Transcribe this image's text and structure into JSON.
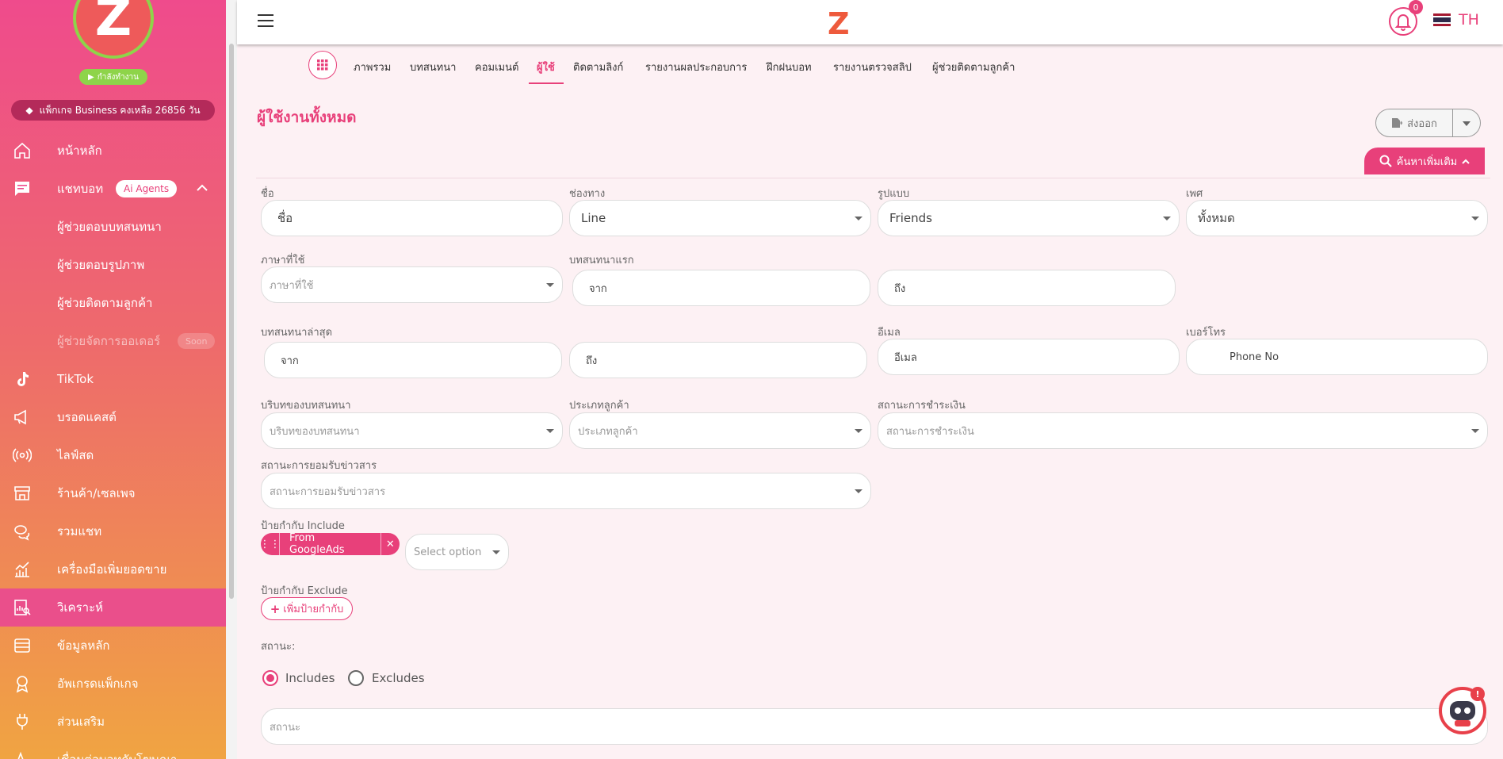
{
  "sidebar": {
    "status_label": "กำลังทำงาน",
    "package_label": "แพ็กเกจ Business คงเหลือ 26856 วัน",
    "items": [
      {
        "label": "หน้าหลัก",
        "icon": "home-icon"
      },
      {
        "label": "แชทบอท",
        "icon": "chat-icon",
        "badge": "Ai Agents"
      },
      {
        "label": "TikTok",
        "icon": "tiktok-icon"
      },
      {
        "label": "บรอดแคสต์",
        "icon": "megaphone-icon"
      },
      {
        "label": "ไลฟ์สด",
        "icon": "live-icon"
      },
      {
        "label": "ร้านค้า/เซลเพจ",
        "icon": "store-icon"
      },
      {
        "label": "รวมแชท",
        "icon": "chats-icon"
      },
      {
        "label": "เครื่องมือเพิ่มยอดขาย",
        "icon": "growth-icon"
      },
      {
        "label": "วิเคราะห์",
        "icon": "analytics-icon"
      },
      {
        "label": "ข้อมูลหลัก",
        "icon": "database-icon"
      },
      {
        "label": "อัพเกรดแพ็กเกจ",
        "icon": "award-icon"
      },
      {
        "label": "ส่วนเสริม",
        "icon": "plug-icon"
      },
      {
        "label": "เชื่อมต่อบอทกับโฆษณา",
        "icon": "ads-icon"
      }
    ],
    "subitems": [
      {
        "label": "ผู้ช่วยตอบบทสนทนา"
      },
      {
        "label": "ผู้ช่วยตอบรูปภาพ"
      },
      {
        "label": "ผู้ช่วยติดตามลูกค้า"
      },
      {
        "label": "ผู้ช่วยจัดการออเดอร์",
        "badge": "Soon"
      }
    ]
  },
  "topbar": {
    "notification_count": "0",
    "language": "TH"
  },
  "tabs": [
    "ภาพรวม",
    "บทสนทนา",
    "คอมเมนต์",
    "ผู้ใช้",
    "ติดตามลิงก์",
    "รายงานผลประกอบการ",
    "ฝึกฝนบอท",
    "รายงานตรวจสลิป",
    "ผู้ช่วยติดตามลูกค้า"
  ],
  "active_tab": "ผู้ใช้",
  "page": {
    "title": "ผู้ใช้งานทั้งหมด",
    "export_label": "ส่งออก",
    "search_more_label": "ค้นหาเพิ่มเติม"
  },
  "filters": {
    "name_label": "ชื่อ",
    "name_placeholder": "ชื่อ",
    "channel_label": "ช่องทาง",
    "channel_value": "Line",
    "type_label": "รูปแบบ",
    "type_value": "Friends",
    "gender_label": "เพศ",
    "gender_value": "ทั้งหมด",
    "language_label": "ภาษาที่ใช้",
    "language_placeholder": "ภาษาที่ใช้",
    "first_chat_label": "บทสนทนาแรก",
    "from_placeholder": "จาก",
    "to_placeholder": "ถึง",
    "last_chat_label": "บทสนทนาล่าสุด",
    "email_label": "อีเมล",
    "email_placeholder": "อีเมล",
    "phone_label": "เบอร์โทร",
    "phone_placeholder": "Phone No",
    "context_label": "บริบทของบทสนทนา",
    "context_placeholder": "บริบทของบทสนทนา",
    "customer_type_label": "ประเภทลูกค้า",
    "customer_type_placeholder": "ประเภทลูกค้า",
    "payment_label": "สถานะการชำระเงิน",
    "payment_placeholder": "สถานะการชำระเงิน",
    "consent_label": "สถานะการยอมรับข่าวสาร",
    "consent_placeholder": "สถานะการยอมรับข่าวสาร",
    "tag_include_label": "ป้ายกำกับ Include",
    "tag_chip": "From GoogleAds",
    "select_option": "Select option",
    "tag_exclude_label": "ป้ายกำกับ Exclude",
    "add_tag_label": "เพิ่มป้ายกำกับ",
    "status_label": "สถานะ:",
    "radio_include": "Includes",
    "radio_exclude": "Excludes",
    "status_placeholder": "สถานะ"
  },
  "colors": {
    "accent": "#e8407a",
    "sidebar_top": "#ef4b8c",
    "sidebar_bottom": "#f0a442"
  }
}
